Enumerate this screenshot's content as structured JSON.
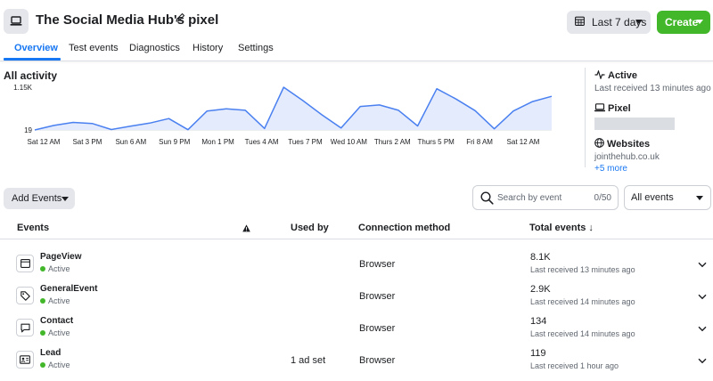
{
  "header": {
    "title": "The Social Media Hub's pixel",
    "date_range_label": "Last 7 days",
    "create_label": "Create"
  },
  "tabs": [
    {
      "label": "Overview",
      "active": true
    },
    {
      "label": "Test events",
      "active": false
    },
    {
      "label": "Diagnostics",
      "active": false
    },
    {
      "label": "History",
      "active": false
    },
    {
      "label": "Settings",
      "active": false
    }
  ],
  "activity": {
    "title": "All activity"
  },
  "chart_data": {
    "type": "area",
    "y_tick_labels": [
      "1.15K",
      "19"
    ],
    "ylim": [
      19,
      1150
    ],
    "x_tick_labels": [
      "Sat 12 AM",
      "Sat 3 PM",
      "Sun 6 AM",
      "Sun 9 PM",
      "Mon 1 PM",
      "Tues 4 AM",
      "Tues 7 PM",
      "Wed 10 AM",
      "Thurs 2 AM",
      "Thurs 5 PM",
      "Fri 8 AM",
      "Sat 12 AM"
    ],
    "values": [
      19,
      140,
      220,
      190,
      30,
      120,
      200,
      320,
      25,
      520,
      580,
      540,
      60,
      1150,
      800,
      420,
      70,
      640,
      680,
      540,
      125,
      1110,
      840,
      530,
      50,
      520,
      770,
      910
    ],
    "line_color": "#4a80f0",
    "fill_color": "#e3ebfd",
    "grid": false
  },
  "side_panel": {
    "active_label": "Active",
    "active_sub": "Last received 13 minutes ago",
    "pixel_label": "Pixel",
    "websites_label": "Websites",
    "website": "jointhehub.co.uk",
    "more_link": "+5 more"
  },
  "filters": {
    "add_events_label": "Add Events",
    "search_placeholder": "Search by event",
    "search_count": "0/50",
    "event_filter_label": "All events"
  },
  "table": {
    "columns": {
      "events": "Events",
      "used_by": "Used by",
      "connection": "Connection method",
      "total": "Total events ↓"
    },
    "rows": [
      {
        "name": "PageView",
        "status": "Active",
        "used_by": "",
        "connection": "Browser",
        "total": "8.1K",
        "last": "Last received 13 minutes ago",
        "icon": "browser-window-icon"
      },
      {
        "name": "GeneralEvent",
        "status": "Active",
        "used_by": "",
        "connection": "Browser",
        "total": "2.9K",
        "last": "Last received 14 minutes ago",
        "icon": "tag-icon"
      },
      {
        "name": "Contact",
        "status": "Active",
        "used_by": "",
        "connection": "Browser",
        "total": "134",
        "last": "Last received 14 minutes ago",
        "icon": "chat-bubble-icon"
      },
      {
        "name": "Lead",
        "status": "Active",
        "used_by": "1 ad set",
        "connection": "Browser",
        "total": "119",
        "last": "Last received 1 hour ago",
        "icon": "contact-card-icon"
      }
    ]
  },
  "colors": {
    "accent": "#1877f2",
    "create": "#42b72a",
    "status_active": "#42b72a"
  }
}
